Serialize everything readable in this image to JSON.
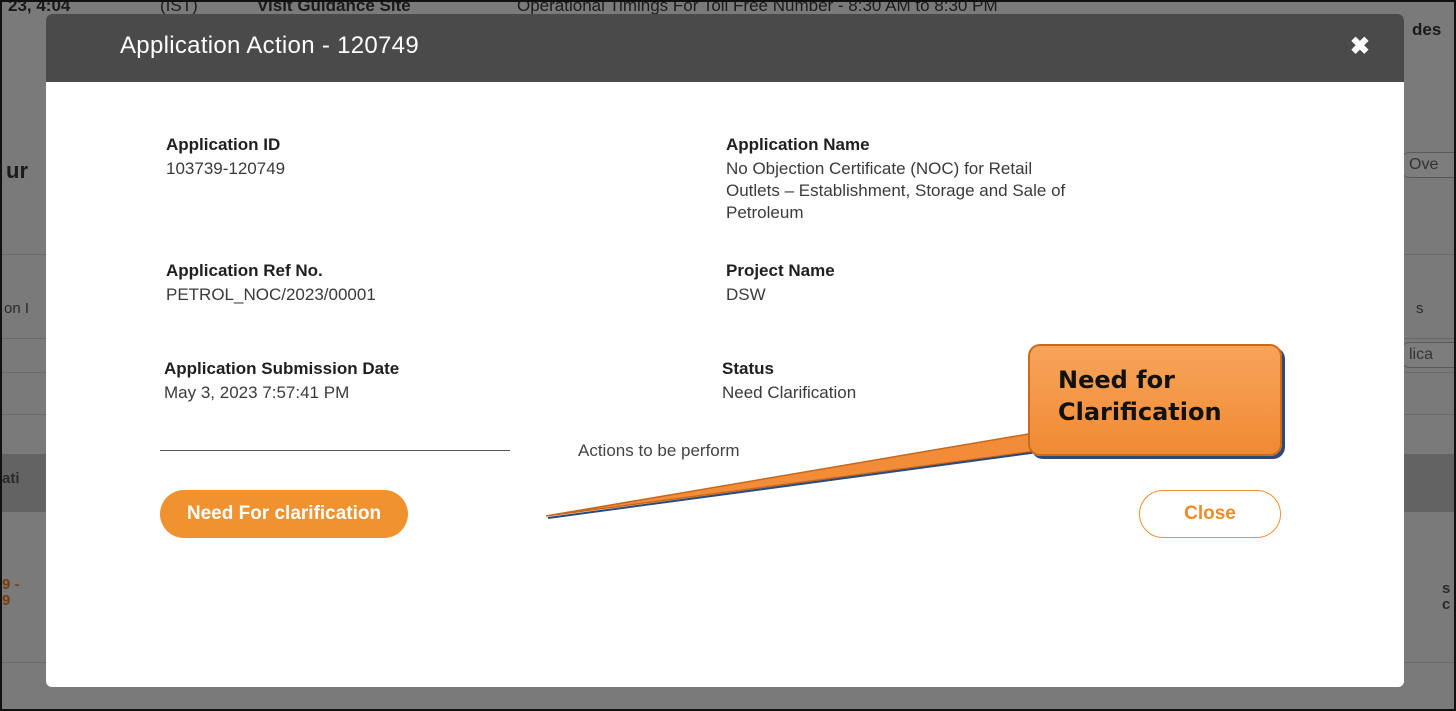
{
  "background": {
    "top_left": "23, 4:04",
    "top_zone": "(IST)",
    "top_link": "Visit Guidance Site",
    "top_notice": "Operational Timings For Toll Free Number - 8:30 AM to 8:30 PM",
    "top_right": "des",
    "heading_fragment": "ur",
    "overview_fragment": "Ove",
    "left_column_fragment": "on I",
    "right_column_fragment": "s",
    "right_box_fragment": "lica",
    "band_left_fragment": "ati",
    "row_left_fragment_1": "9 -",
    "row_left_fragment_2": "9",
    "row_right_fragment_1": "s",
    "row_right_fragment_2": "c"
  },
  "modal": {
    "title": "Application Action - 120749",
    "close_icon": "close-icon"
  },
  "fields": {
    "app_id_label": "Application ID",
    "app_id_value": "103739-120749",
    "app_name_label": "Application Name",
    "app_name_line1": "No Objection Certificate (NOC) for Retail",
    "app_name_line2": "Outlets – Establishment, Storage and Sale of",
    "app_name_line3": "Petroleum",
    "ref_label": "Application Ref No.",
    "ref_value": "PETROL_NOC/2023/00001",
    "project_label": "Project Name",
    "project_value": "DSW",
    "submission_label": "Application Submission Date",
    "submission_value": "May 3, 2023 7:57:41 PM",
    "status_label": "Status",
    "status_value": "Need Clarification"
  },
  "actions": {
    "section_label": "Actions to be perform",
    "need_clarification_button": "Need For clarification",
    "close_button": "Close"
  },
  "callout": {
    "text": "Need for\nClarification"
  },
  "colors": {
    "accent": "#f0922f",
    "header": "#4a4a4a",
    "callout": "#f39a45"
  }
}
